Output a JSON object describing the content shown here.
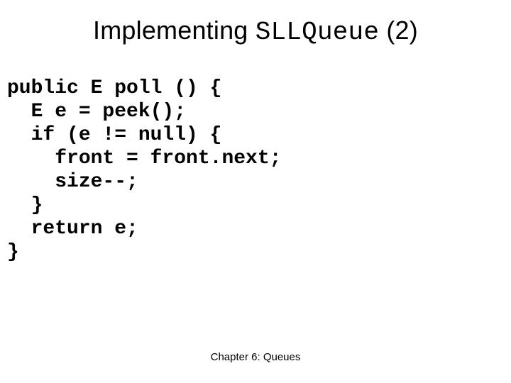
{
  "title": {
    "prefix": "Implementing ",
    "classname": "SLLQueue",
    "suffix": " (2)"
  },
  "code": "public E poll () {\n  E e = peek();\n  if (e != null) {\n    front = front.next;\n    size--;\n  }\n  return e;\n}",
  "footer": "Chapter 6: Queues"
}
